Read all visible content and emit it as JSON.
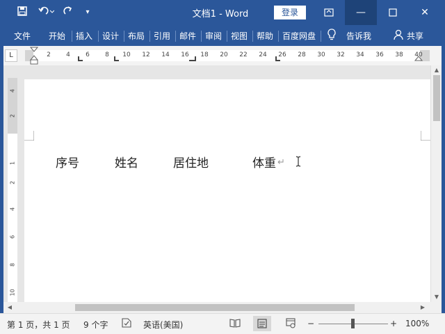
{
  "titlebar": {
    "title": "文档1 - Word",
    "login_label": "登录",
    "icons": [
      "save-icon",
      "undo-icon",
      "redo-icon",
      "customize-quick-access-icon",
      "ribbon-display-options-icon",
      "minimize-icon",
      "maximize-icon",
      "close-icon"
    ]
  },
  "ribbon": {
    "tabs": [
      {
        "label": "文件"
      },
      {
        "label": "开始"
      },
      {
        "label": "插入"
      },
      {
        "label": "设计"
      },
      {
        "label": "布局"
      },
      {
        "label": "引用"
      },
      {
        "label": "邮件"
      },
      {
        "label": "审阅"
      },
      {
        "label": "视图"
      },
      {
        "label": "帮助"
      },
      {
        "label": "百度网盘"
      }
    ],
    "tell_me": "告诉我",
    "share": "共享"
  },
  "ruler": {
    "tab_selector": "L",
    "numbers": [
      "2",
      "4",
      "6",
      "8",
      "10",
      "12",
      "14",
      "16",
      "18",
      "20",
      "22",
      "24",
      "26",
      "28",
      "30",
      "32",
      "34",
      "36",
      "38",
      "40"
    ],
    "vertical_numbers": [
      "4",
      "2",
      "1",
      "2",
      "4",
      "6",
      "8",
      "10"
    ]
  },
  "document": {
    "words": [
      "序号",
      "姓名",
      "居住地",
      "体重"
    ],
    "paragraph_mark": "↵"
  },
  "statusbar": {
    "page": "第 1 页，共 1 页",
    "word_count": "9 个字",
    "language": "英语(美国)",
    "zoom_minus": "−",
    "zoom_plus": "+",
    "zoom": "100%",
    "zoom_level": 0.5
  },
  "colors": {
    "brand": "#2b579a",
    "active_button": "#1e4378"
  }
}
